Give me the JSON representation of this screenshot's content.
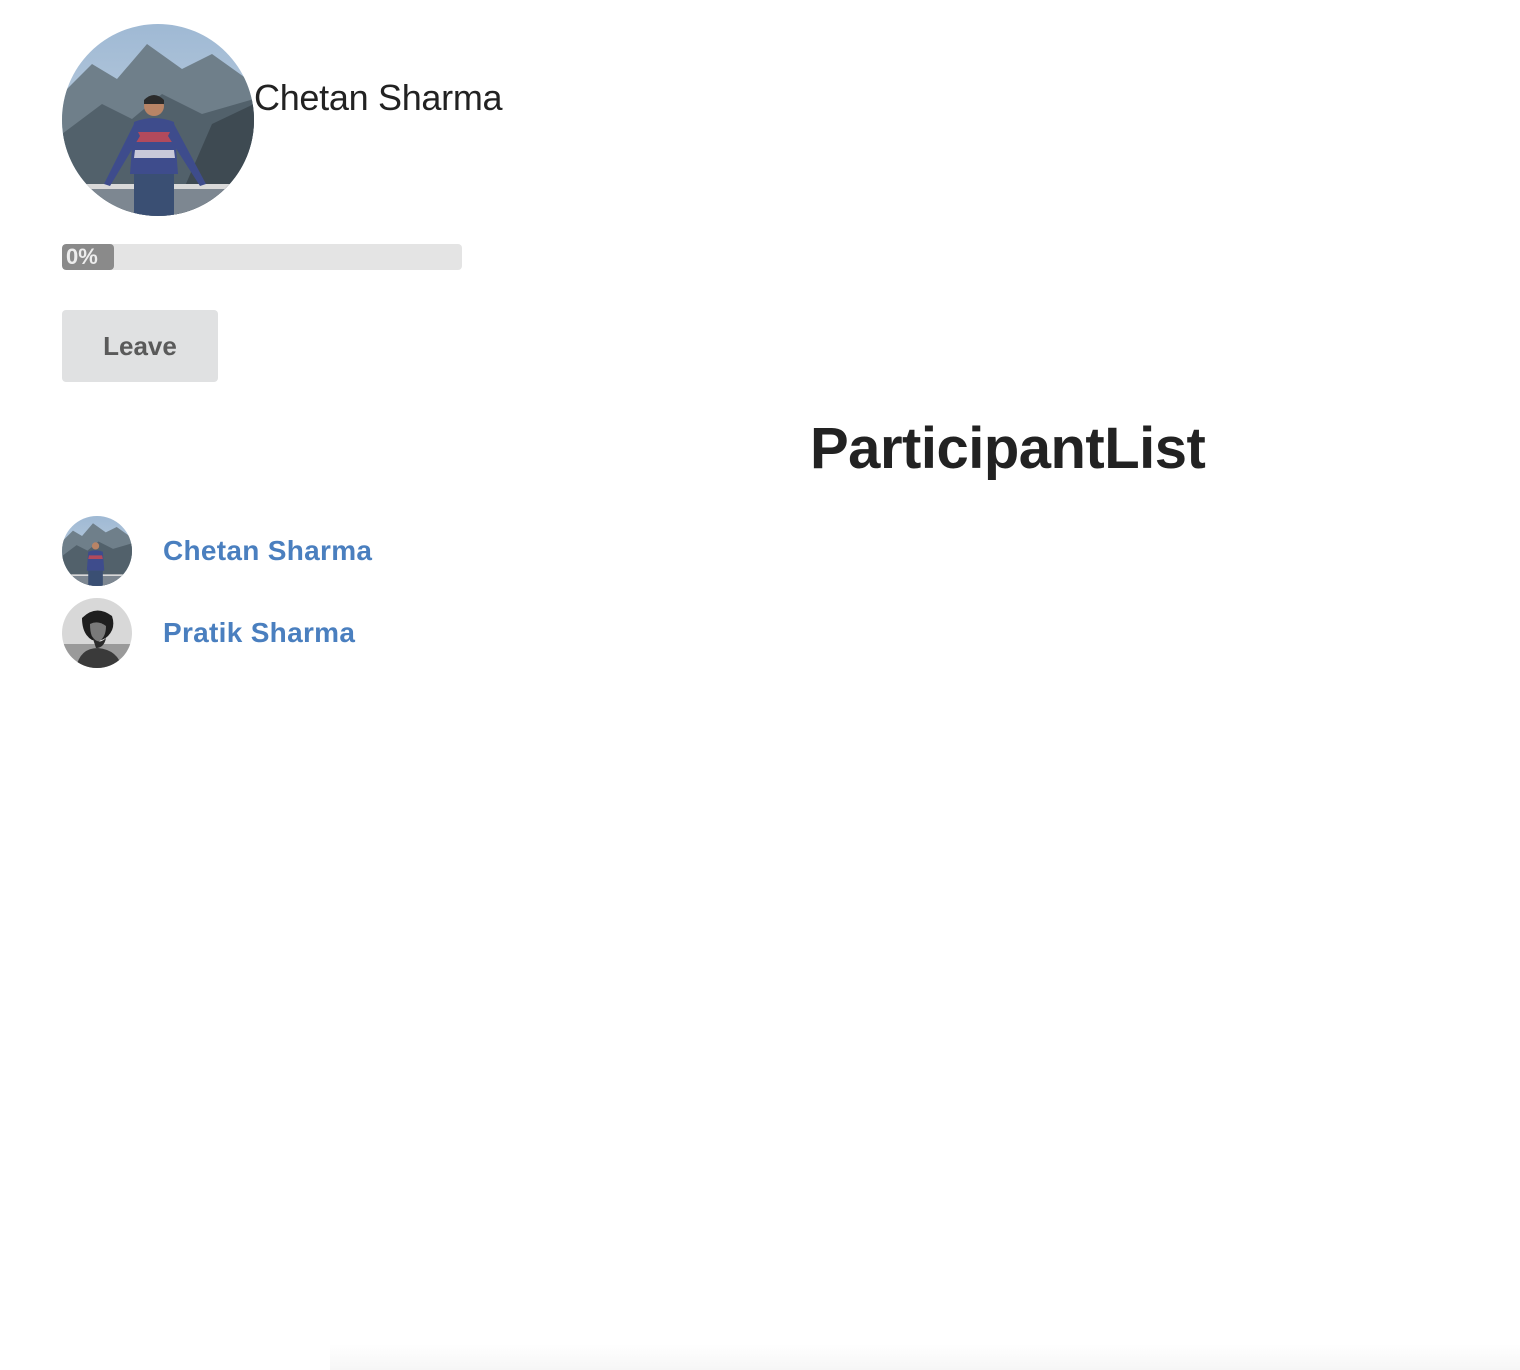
{
  "current_user": {
    "name": "Chetan Sharma",
    "avatar_icon": "user-photo-mountains"
  },
  "progress": {
    "label": "0%",
    "value_percent": 0
  },
  "leave_button": {
    "label": "Leave"
  },
  "participant_list": {
    "title": "ParticipantList",
    "items": [
      {
        "name": "Chetan Sharma",
        "avatar_icon": "user-photo-mountains"
      },
      {
        "name": "Pratik Sharma",
        "avatar_icon": "user-photo-monochrome"
      }
    ]
  },
  "colors": {
    "link": "#4a7fbf",
    "button_bg": "#e0e1e2",
    "progress_track": "#e4e4e4",
    "progress_fill": "#8a8a8a"
  }
}
